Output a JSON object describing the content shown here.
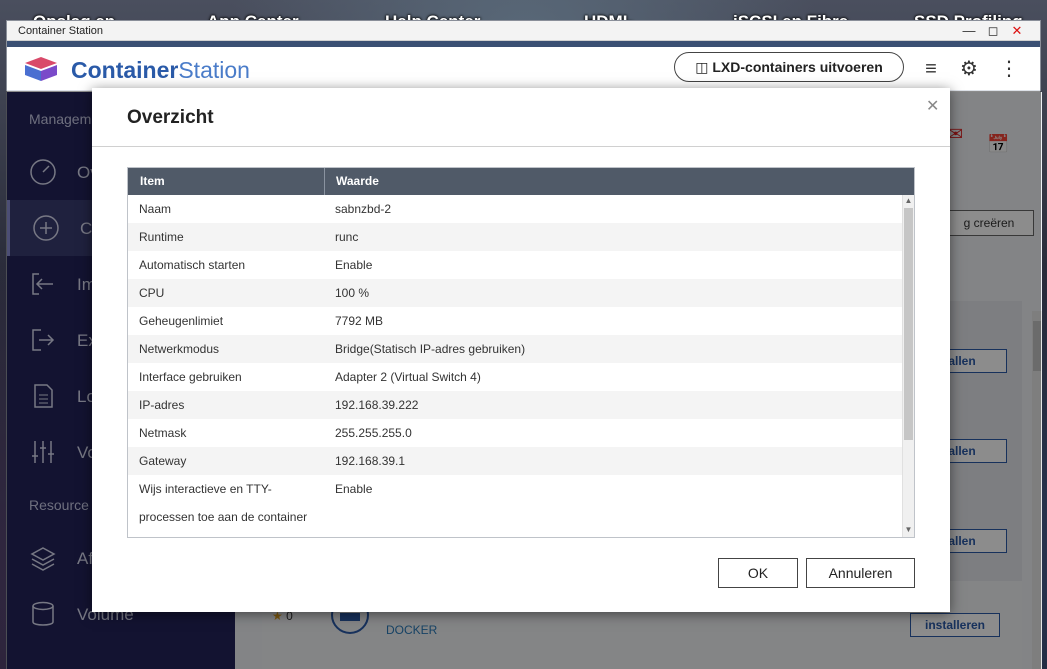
{
  "desktop": {
    "icons": [
      "Opslag en",
      "App Center",
      "Help Center",
      "HDMI-",
      "iSCSI en Fibre",
      "SSD Profiling"
    ]
  },
  "window": {
    "title": "Container Station",
    "app_name_bold": "Container",
    "app_name_light": "Station",
    "lxd_button": "LXD-containers uitvoeren"
  },
  "sidebar": {
    "section_management": "Managem",
    "section_resource": "Resource",
    "items": [
      {
        "label": "Ov"
      },
      {
        "label": "Cr"
      },
      {
        "label": "Im"
      },
      {
        "label": "Ex"
      },
      {
        "label": "Lo"
      },
      {
        "label": "Vo"
      },
      {
        "label": "Af"
      },
      {
        "label": "Volume"
      }
    ]
  },
  "main": {
    "create_button": "g creëren",
    "install_labels": [
      "allen",
      "allen",
      "allen",
      "installeren"
    ],
    "docker_label": "DOCKER",
    "rating": "0"
  },
  "modal": {
    "title": "Overzicht",
    "columns": [
      "Item",
      "Waarde"
    ],
    "rows": [
      {
        "item": "Naam",
        "value": "sabnzbd-2"
      },
      {
        "item": "Runtime",
        "value": "runc"
      },
      {
        "item": "Automatisch starten",
        "value": "Enable"
      },
      {
        "item": "CPU",
        "value": "100 %"
      },
      {
        "item": "Geheugenlimiet",
        "value": "7792 MB"
      },
      {
        "item": "Netwerkmodus",
        "value": "Bridge(Statisch IP-adres gebruiken)"
      },
      {
        "item": "Interface gebruiken",
        "value": "Adapter 2 (Virtual Switch 4)"
      },
      {
        "item": "IP-adres",
        "value": "192.168.39.222"
      },
      {
        "item": "Netmask",
        "value": "255.255.255.0"
      },
      {
        "item": "Gateway",
        "value": "192.168.39.1"
      },
      {
        "item": "Wijs interactieve en TTY-",
        "value": "Enable"
      },
      {
        "item": "processen toe aan de container",
        "value": ""
      }
    ],
    "ok_button": "OK",
    "cancel_button": "Annuleren"
  }
}
